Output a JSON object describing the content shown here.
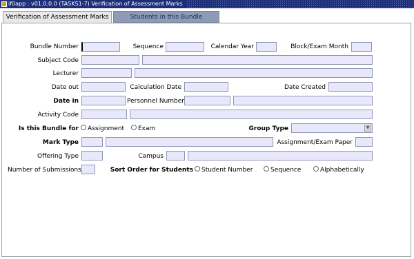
{
  "window": {
    "title": "if0app : v01.0.0.0 (TASKS1-7) Verification of Assessment Marks"
  },
  "tabs": [
    {
      "label": "Verification of Assessment Marks"
    },
    {
      "label": "Students in this Bundle"
    }
  ],
  "form": {
    "bundle_number": {
      "label": "Bundle Number",
      "value": ""
    },
    "sequence": {
      "label": "Sequence",
      "value": ""
    },
    "calendar_year": {
      "label": "Calendar Year",
      "value": ""
    },
    "block_exam_month": {
      "label": "Block/Exam Month",
      "value": ""
    },
    "subject_code": {
      "label": "Subject Code",
      "value": "",
      "desc": ""
    },
    "lecturer": {
      "label": "Lecturer",
      "value": "",
      "desc": ""
    },
    "date_out": {
      "label": "Date out",
      "value": ""
    },
    "calculation_date": {
      "label": "Calculation Date",
      "value": ""
    },
    "date_created": {
      "label": "Date Created",
      "value": ""
    },
    "date_in": {
      "label": "Date in",
      "value": ""
    },
    "personnel_number": {
      "label": "Personnel Number",
      "value": "",
      "desc": ""
    },
    "activity_code": {
      "label": "Activity Code",
      "value": "",
      "desc": ""
    },
    "bundle_for": {
      "label": "Is this Bundle for",
      "options": [
        {
          "label": "Assignment",
          "underline": "t"
        },
        {
          "label": "Exam",
          "underline": "E"
        }
      ]
    },
    "group_type": {
      "label": "Group Type",
      "value": ""
    },
    "mark_type": {
      "label": "Mark Type",
      "value": "",
      "desc": ""
    },
    "assignment_exam_paper": {
      "label": "Assignment/Exam Paper",
      "value": ""
    },
    "offering_type": {
      "label": "Offering Type",
      "value": ""
    },
    "campus": {
      "label": "Campus",
      "value": "",
      "desc": ""
    },
    "number_of_submissions": {
      "label": "Number of Submissions",
      "value": ""
    },
    "sort_order": {
      "label": "Sort Order for Students",
      "options": [
        {
          "label": "Student Number"
        },
        {
          "label": "Sequence"
        },
        {
          "label": "Alphabetically"
        }
      ]
    }
  },
  "colors": {
    "titlebar": "#1e2f7a",
    "field_bg": "#e8e8fa",
    "field_border": "#8e95b8",
    "inactive_tab": "#8e9bb6"
  },
  "icons": {
    "app": "app-icon",
    "dropdown": "chevron-down-icon"
  }
}
